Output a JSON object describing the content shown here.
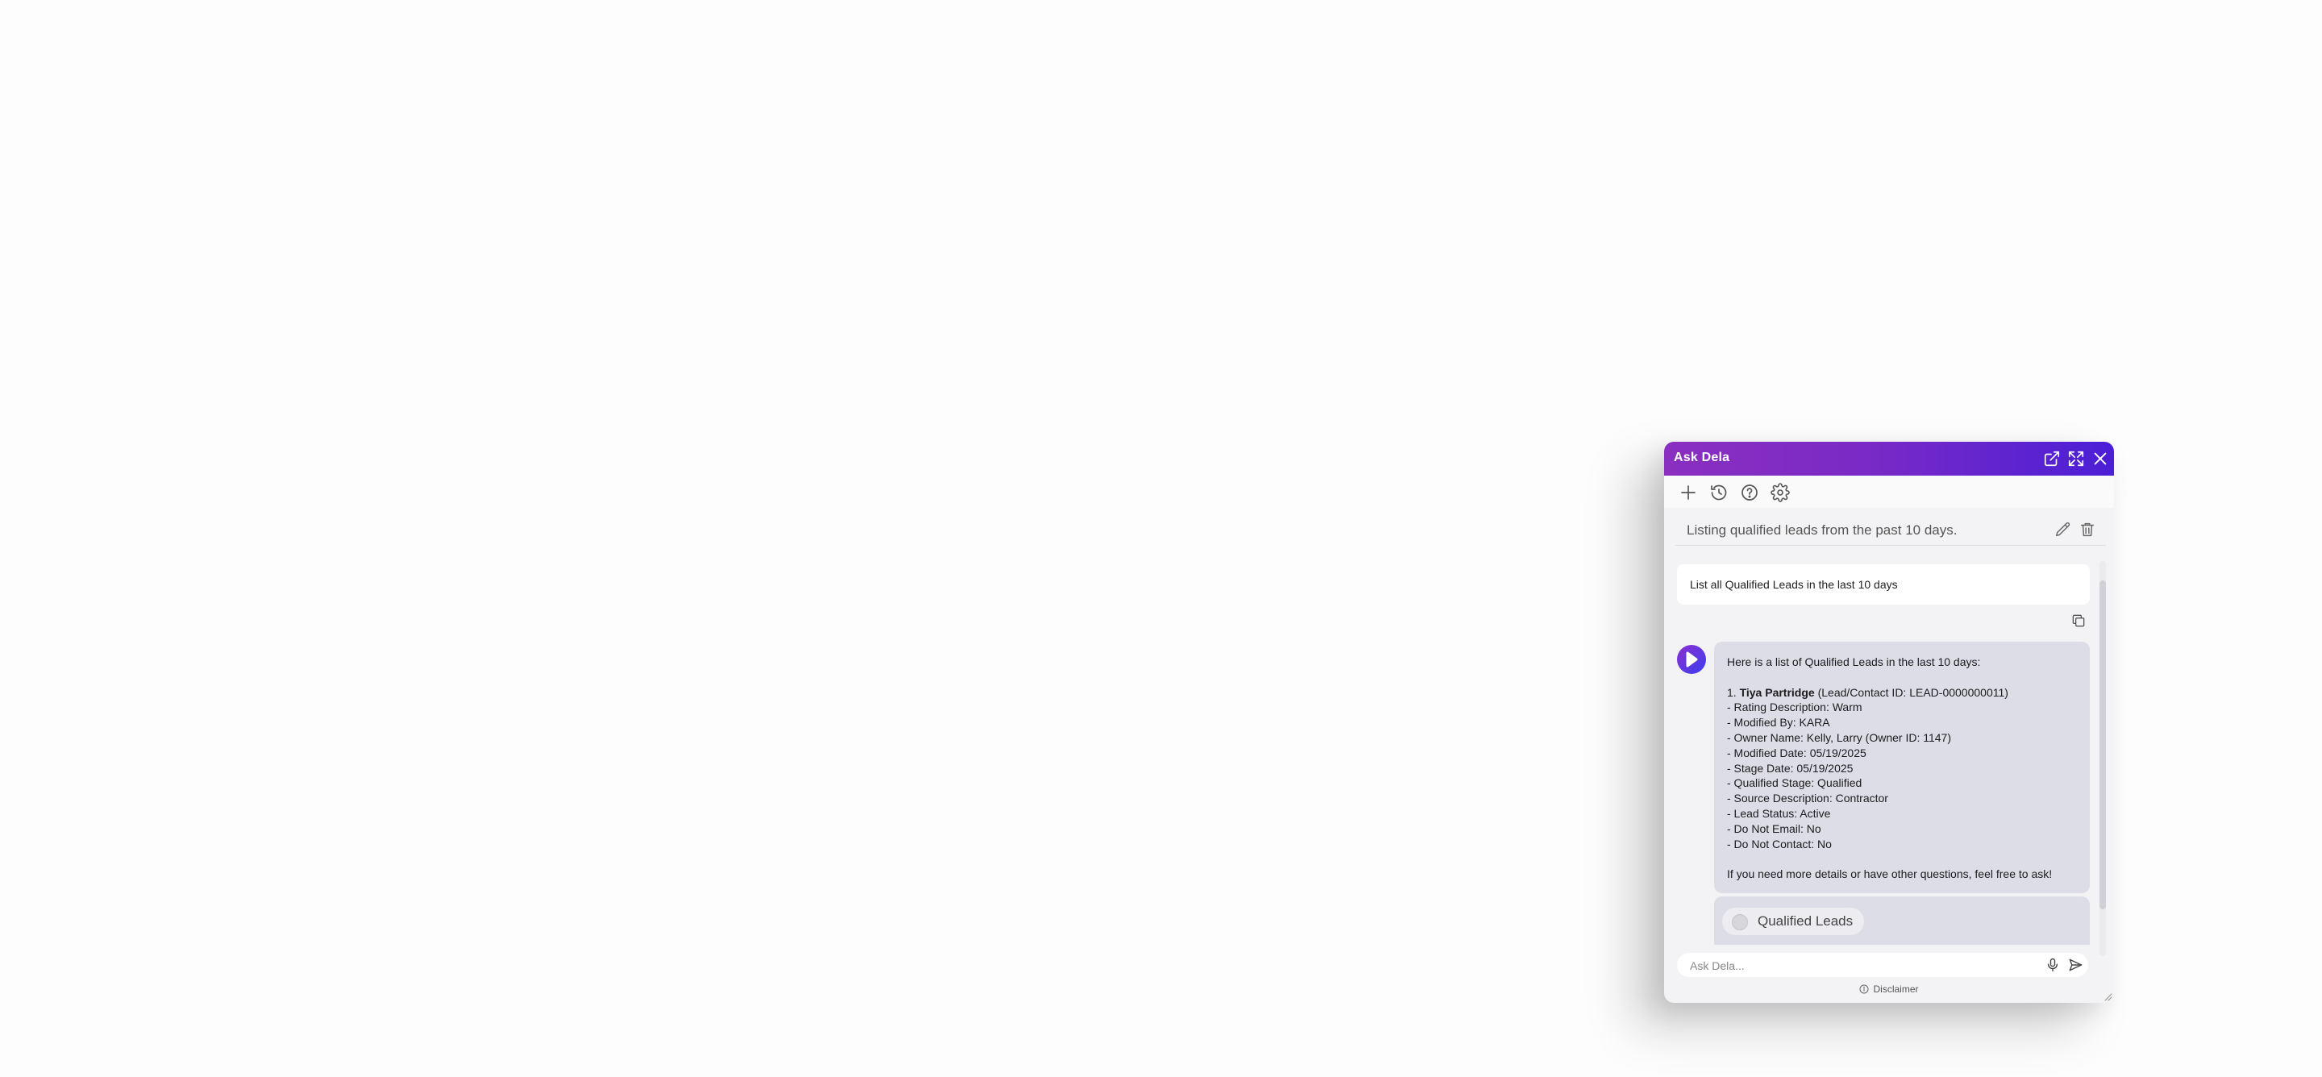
{
  "window": {
    "title": "Ask Dela"
  },
  "conversation": {
    "title": "Listing qualified leads from the past 10 days."
  },
  "user_message": {
    "text": "List all Qualified Leads in the last 10 days"
  },
  "bot_message": {
    "intro": "Here is a list of Qualified Leads in the last 10 days:",
    "item_number": "1.",
    "lead_name": "Tiya Partridge",
    "lead_id_text": "(Lead/Contact ID: LEAD-0000000011)",
    "details": [
      "- Rating Description: Warm",
      "- Modified By: KARA",
      "- Owner Name: Kelly, Larry (Owner ID: 1147)",
      "- Modified Date: 05/19/2025",
      "- Stage Date: 05/19/2025",
      "- Qualified Stage: Qualified",
      "- Source Description: Contractor",
      "- Lead Status: Active",
      "- Do Not Email: No",
      "- Do Not Contact: No"
    ],
    "outro": "If you need more details or have other questions, feel free to ask!"
  },
  "suggestion_chip": {
    "label": "Qualified Leads"
  },
  "input": {
    "placeholder": "Ask Dela..."
  },
  "footer": {
    "disclaimer": "Disclaimer"
  },
  "colors": {
    "header_start": "#8a2fc0",
    "header_end": "#4b1fd6",
    "bot_bubble": "#dddde8",
    "user_bubble": "#ffffff"
  }
}
